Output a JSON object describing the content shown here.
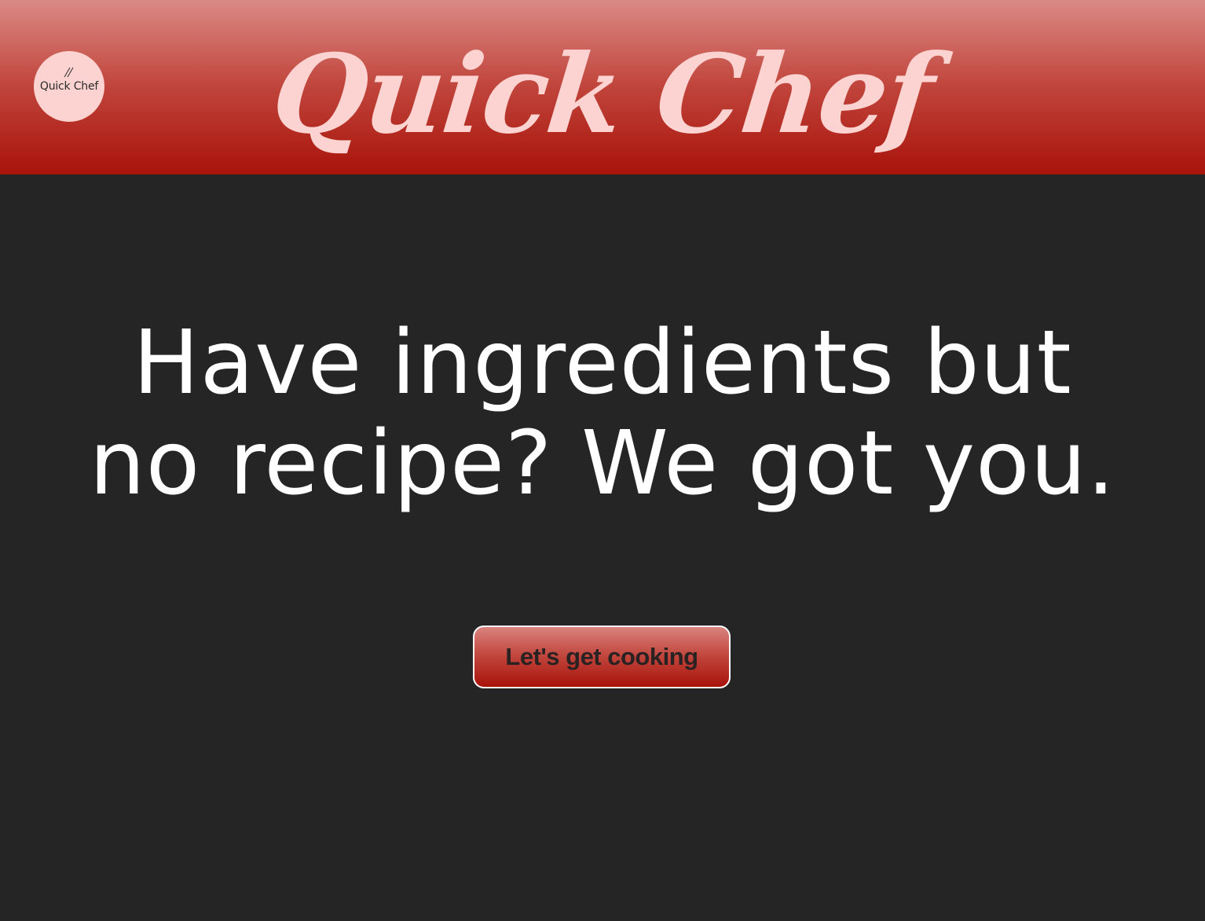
{
  "header": {
    "logo_text": "Quick Chef",
    "logo_icon": "chopsticks-icon",
    "title": "Quick Chef"
  },
  "hero": {
    "line1": "Have ingredients but",
    "line2": "no recipe? We got you."
  },
  "cta": {
    "label": "Let's get cooking"
  },
  "colors": {
    "background": "#252525",
    "header_top": "#db8a85",
    "header_bottom": "#a8130a",
    "title_pink": "#fcd3d0",
    "hero_text": "#ffffff"
  }
}
